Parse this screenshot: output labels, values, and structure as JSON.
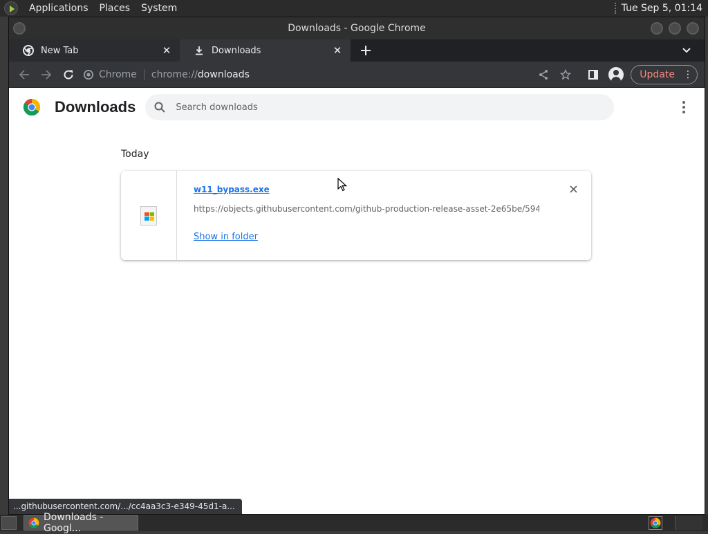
{
  "top_panel": {
    "menus": [
      "Applications",
      "Places",
      "System"
    ],
    "clock": "Tue Sep  5, 01:14"
  },
  "window": {
    "title": "Downloads - Google Chrome"
  },
  "tabs": [
    {
      "label": "New Tab",
      "icon": "chrome-icon"
    },
    {
      "label": "Downloads",
      "icon": "download-icon"
    }
  ],
  "toolbar": {
    "site_chip": "Chrome",
    "url_scheme": "chrome://",
    "url_host": "downloads",
    "update_label": "Update"
  },
  "downloads_page": {
    "title": "Downloads",
    "search_placeholder": "Search downloads",
    "section_date": "Today",
    "items": [
      {
        "file_name": "w11_bypass.exe",
        "url": "https://objects.githubusercontent.com/github-production-release-asset-2e65be/594...",
        "action_label": "Show in folder"
      }
    ]
  },
  "status_bubble": "...githubusercontent.com/.../cc4aa3c3-e349-45d1-a...",
  "taskbar": {
    "task_label": "Downloads - Googl..."
  },
  "colors": {
    "link": "#1a73e8",
    "update_text": "#f28b82",
    "chrome_dark": "#35363a"
  }
}
